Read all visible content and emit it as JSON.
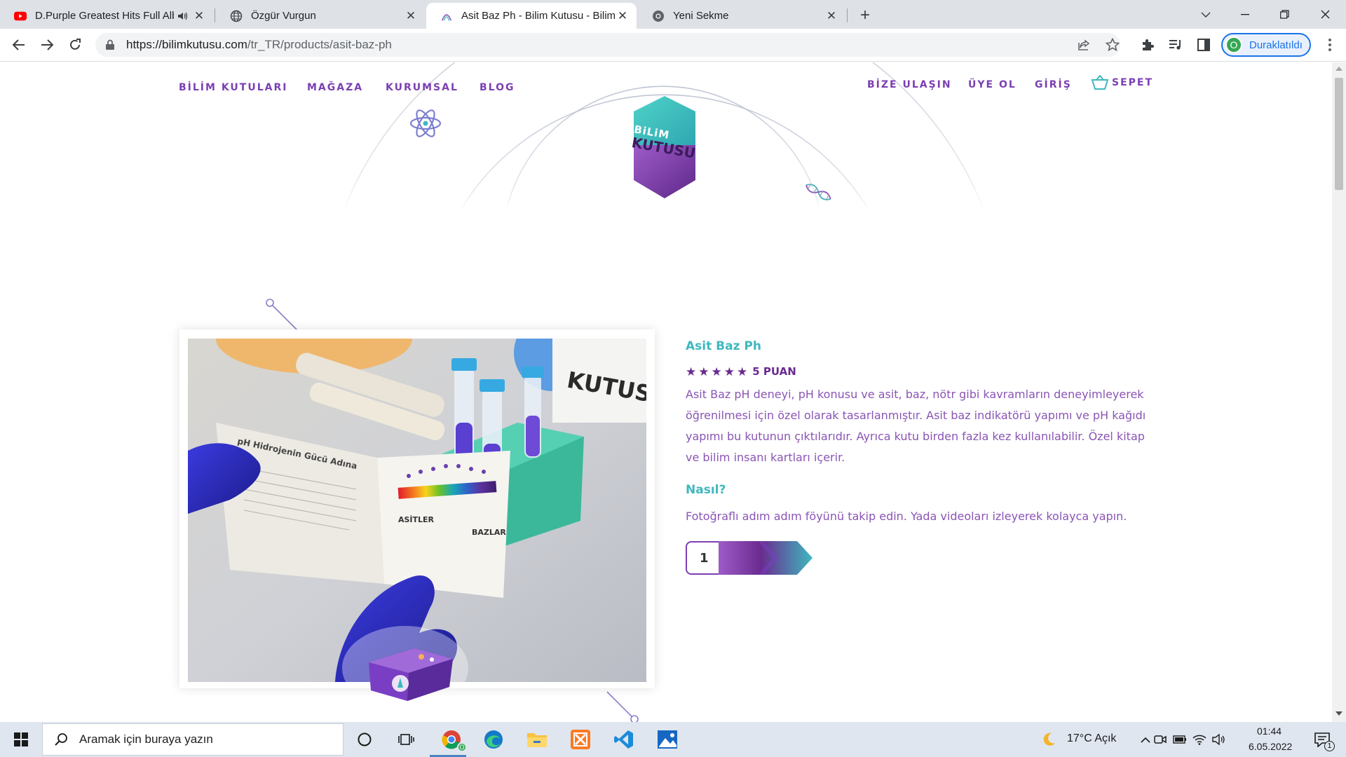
{
  "browser": {
    "tabs": [
      {
        "title": "D.Purple Greatest Hits Full Album",
        "icon": "youtube-icon"
      },
      {
        "title": "Özgür Vurgun",
        "icon": "globe-icon"
      },
      {
        "title": "Asit Baz Ph - Bilim Kutusu - Bilim",
        "icon": "bilim-kutusu-icon"
      },
      {
        "title": "Yeni Sekme",
        "icon": "chrome-icon"
      }
    ],
    "url_host": "https://bilimkutusu.com",
    "url_path": "/tr_TR/products/asit-baz-ph",
    "profile_initial": "O",
    "profile_status": "Duraklatıldı"
  },
  "site": {
    "nav_left": [
      "BİLİM KUTULARI",
      "MAĞAZA",
      "KURUMSAL",
      "BLOG"
    ],
    "nav_right": [
      "BİZE ULAŞIN",
      "ÜYE OL",
      "GİRİŞ",
      "SEPET"
    ],
    "logo_line1": "BiLiM",
    "logo_line2": "KUTUSU",
    "colors": {
      "purple": "#7b3fb3",
      "teal": "#3fb8bf",
      "dark_purple": "#6a2b8f"
    }
  },
  "product": {
    "title": "Asit Baz Ph",
    "rating": 5,
    "rating_label": "5 PUAN",
    "description": "Asit Baz pH deneyi, pH konusu ve asit, baz, nötr gibi kavramların deneyimleyerek öğrenilmesi için özel olarak tasarlanmıştır. Asit baz indikatörü yapımı ve pH kağıdı yapımı bu kutunun çıktılarıdır. Ayrıca kutu birden fazla kez kullanılabilir. Özel kitap ve bilim insanı kartları içerir.",
    "how_title": "Nasıl?",
    "how_text": "Fotoğraflı adım adım föyünü takip edin. Yada videoları izleyerek kolayca yapın.",
    "quantity": "1",
    "image_texts": {
      "book_heading": "pH Hidrojenin Gücü Adına",
      "acids": "ASİTLER",
      "bases": "BAZLAR",
      "box_label": "KUTUS"
    }
  },
  "taskbar": {
    "search_placeholder": "Aramak için buraya yazın",
    "weather": "17°C  Açık",
    "time": "01:44",
    "date": "6.05.2022",
    "notification_count": "1"
  }
}
